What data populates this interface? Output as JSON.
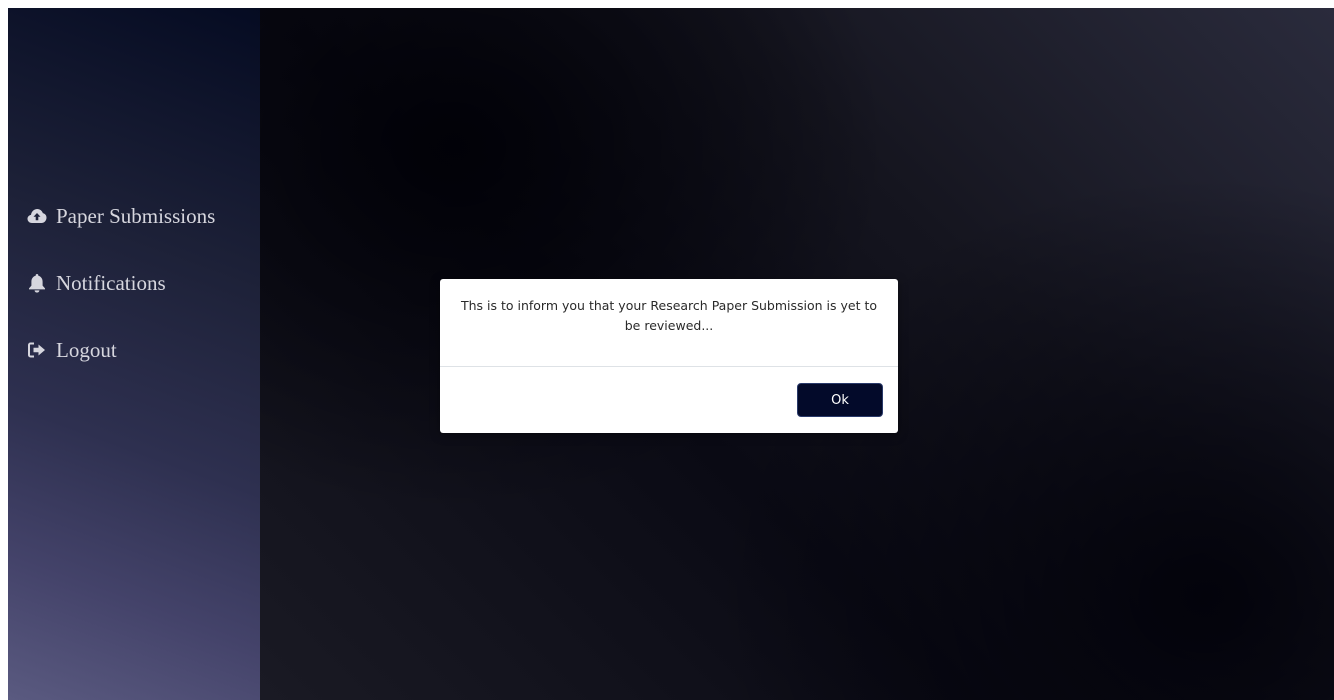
{
  "sidebar": {
    "items": [
      {
        "label": "Paper Submissions",
        "icon": "cloud-upload-icon"
      },
      {
        "label": "Notifications",
        "icon": "bell-icon"
      },
      {
        "label": "Logout",
        "icon": "sign-out-icon"
      }
    ]
  },
  "modal": {
    "message": "Ths is to inform you that your Research Paper Submission is yet to be reviewed...",
    "ok_label": "Ok"
  },
  "colors": {
    "sidebar_top": "#050b22",
    "sidebar_bottom": "#5a5a80",
    "button_bg": "#030a2a",
    "nav_text": "#d6d6de"
  }
}
